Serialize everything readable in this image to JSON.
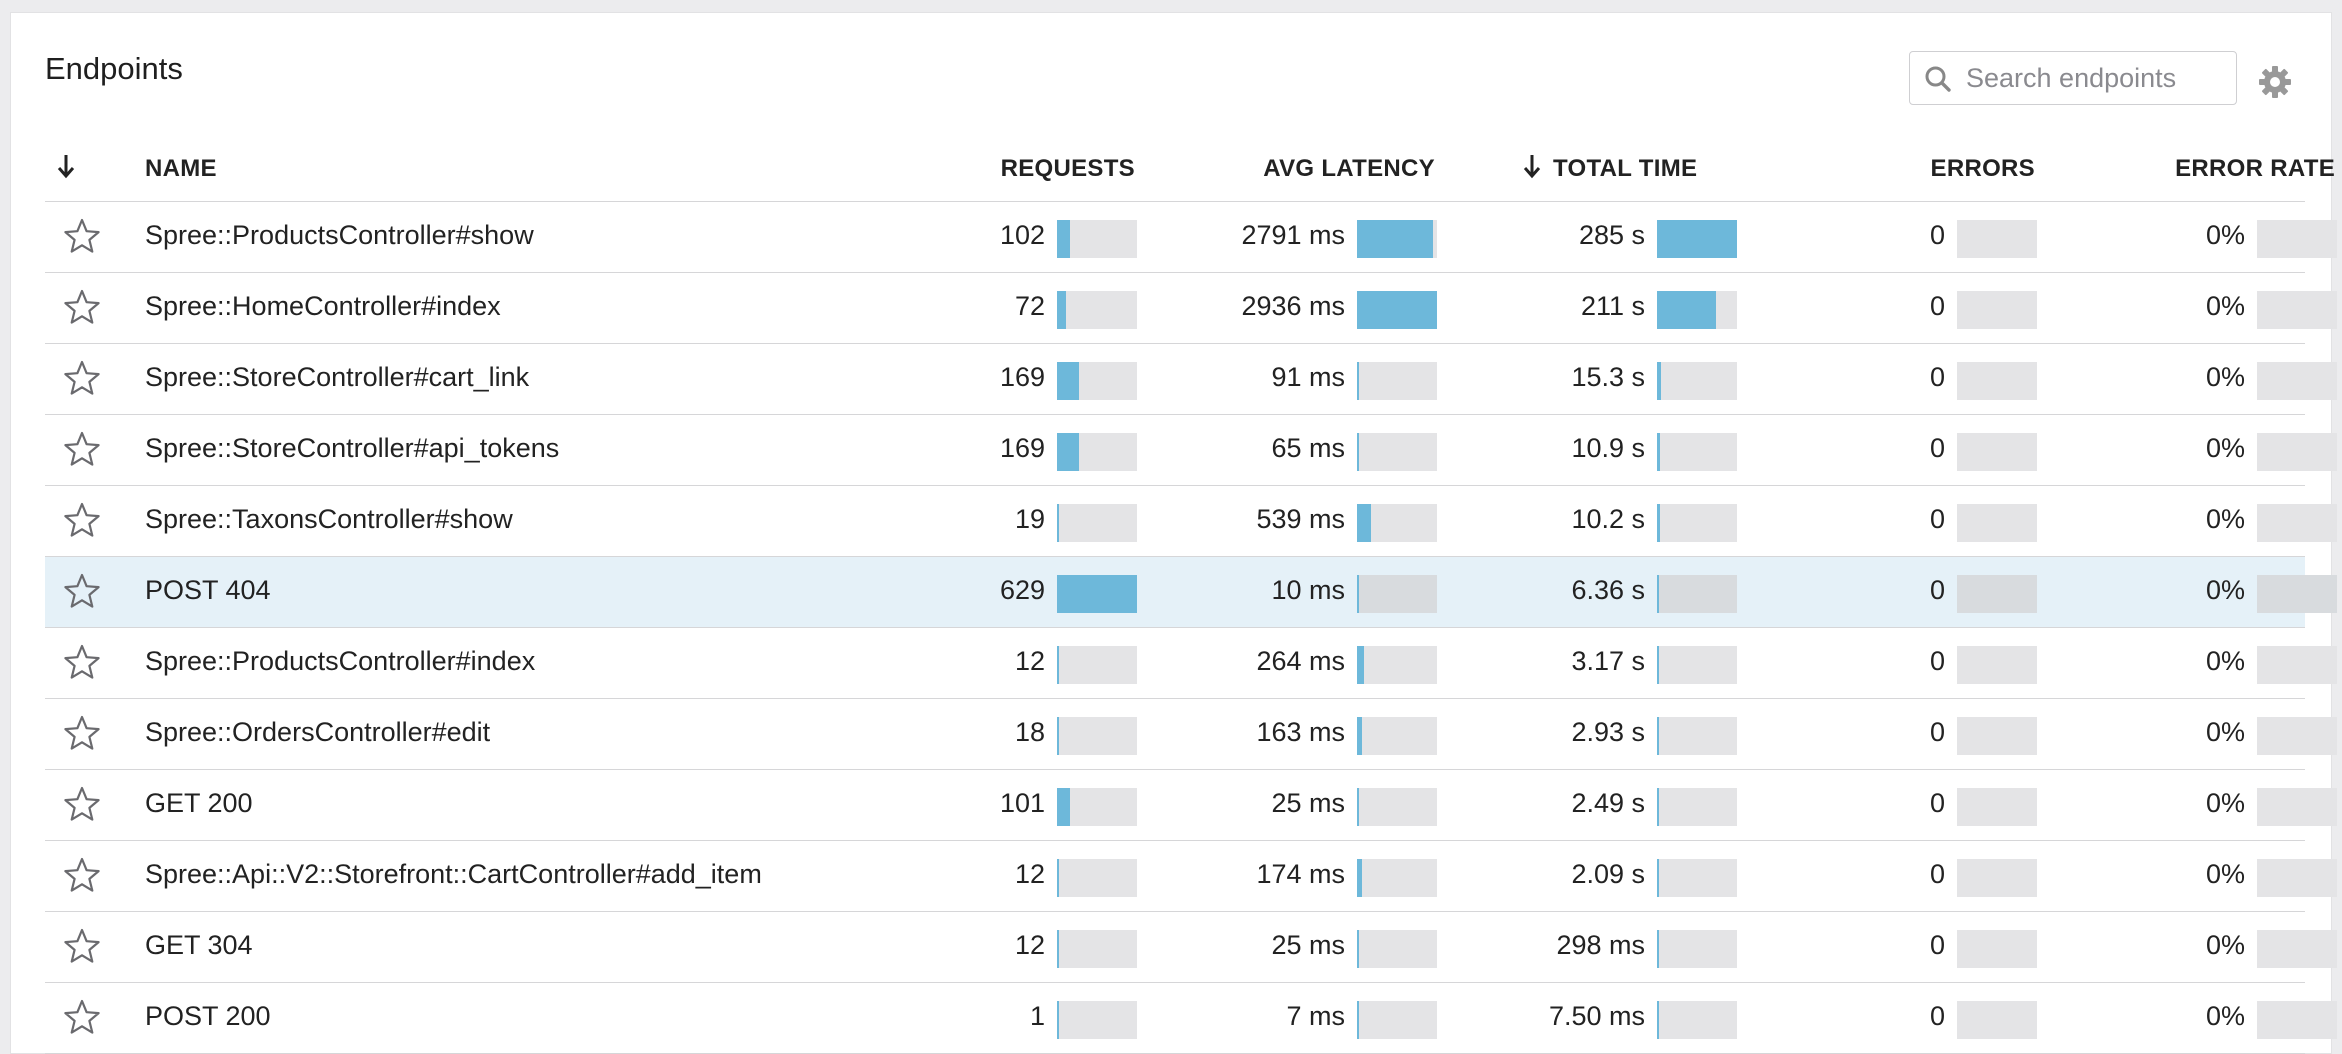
{
  "panel": {
    "title": "Endpoints",
    "search": {
      "placeholder": "Search endpoints",
      "value": ""
    },
    "icons": {
      "search": "search-icon",
      "settings": "gear-icon",
      "favorite": "star-outline-icon",
      "sort": "arrow-down-icon"
    }
  },
  "colors": {
    "bar_fill": "#6db8da",
    "bar_track": "#e4e4e6",
    "row_highlight": "#e5f1f8"
  },
  "columns": {
    "name": "NAME",
    "requests": "REQUESTS",
    "avg_latency": "AVG LATENCY",
    "total_time": "TOTAL TIME",
    "errors": "ERRORS",
    "error_rate": "ERROR RATE"
  },
  "rows": [
    {
      "name": "Spree::ProductsController#show",
      "requests": "102",
      "requests_bar": 0.16,
      "avg_latency": "2791 ms",
      "latency_bar": 0.95,
      "total_time": "285 s",
      "time_bar": 1.0,
      "errors": "0",
      "error_rate": "0%",
      "highlighted": false
    },
    {
      "name": "Spree::HomeController#index",
      "requests": "72",
      "requests_bar": 0.11,
      "avg_latency": "2936 ms",
      "latency_bar": 1.0,
      "total_time": "211 s",
      "time_bar": 0.74,
      "errors": "0",
      "error_rate": "0%",
      "highlighted": false
    },
    {
      "name": "Spree::StoreController#cart_link",
      "requests": "169",
      "requests_bar": 0.27,
      "avg_latency": "91 ms",
      "latency_bar": 0.03,
      "total_time": "15.3 s",
      "time_bar": 0.05,
      "errors": "0",
      "error_rate": "0%",
      "highlighted": false
    },
    {
      "name": "Spree::StoreController#api_tokens",
      "requests": "169",
      "requests_bar": 0.27,
      "avg_latency": "65 ms",
      "latency_bar": 0.02,
      "total_time": "10.9 s",
      "time_bar": 0.04,
      "errors": "0",
      "error_rate": "0%",
      "highlighted": false
    },
    {
      "name": "Spree::TaxonsController#show",
      "requests": "19",
      "requests_bar": 0.03,
      "avg_latency": "539 ms",
      "latency_bar": 0.18,
      "total_time": "10.2 s",
      "time_bar": 0.04,
      "errors": "0",
      "error_rate": "0%",
      "highlighted": false
    },
    {
      "name": "POST 404",
      "requests": "629",
      "requests_bar": 1.0,
      "avg_latency": "10 ms",
      "latency_bar": 0.0,
      "total_time": "6.36 s",
      "time_bar": 0.02,
      "errors": "0",
      "error_rate": "0%",
      "highlighted": true
    },
    {
      "name": "Spree::ProductsController#index",
      "requests": "12",
      "requests_bar": 0.02,
      "avg_latency": "264 ms",
      "latency_bar": 0.09,
      "total_time": "3.17 s",
      "time_bar": 0.01,
      "errors": "0",
      "error_rate": "0%",
      "highlighted": false
    },
    {
      "name": "Spree::OrdersController#edit",
      "requests": "18",
      "requests_bar": 0.03,
      "avg_latency": "163 ms",
      "latency_bar": 0.06,
      "total_time": "2.93 s",
      "time_bar": 0.01,
      "errors": "0",
      "error_rate": "0%",
      "highlighted": false
    },
    {
      "name": "GET 200",
      "requests": "101",
      "requests_bar": 0.16,
      "avg_latency": "25 ms",
      "latency_bar": 0.01,
      "total_time": "2.49 s",
      "time_bar": 0.01,
      "errors": "0",
      "error_rate": "0%",
      "highlighted": false
    },
    {
      "name": "Spree::Api::V2::Storefront::CartController#add_item",
      "requests": "12",
      "requests_bar": 0.02,
      "avg_latency": "174 ms",
      "latency_bar": 0.06,
      "total_time": "2.09 s",
      "time_bar": 0.01,
      "errors": "0",
      "error_rate": "0%",
      "highlighted": false
    },
    {
      "name": "GET 304",
      "requests": "12",
      "requests_bar": 0.02,
      "avg_latency": "25 ms",
      "latency_bar": 0.0,
      "total_time": "298 ms",
      "time_bar": 0.0,
      "errors": "0",
      "error_rate": "0%",
      "highlighted": false
    },
    {
      "name": "POST 200",
      "requests": "1",
      "requests_bar": 0.0,
      "avg_latency": "7 ms",
      "latency_bar": 0.0,
      "total_time": "7.50 ms",
      "time_bar": 0.0,
      "errors": "0",
      "error_rate": "0%",
      "highlighted": false
    }
  ]
}
